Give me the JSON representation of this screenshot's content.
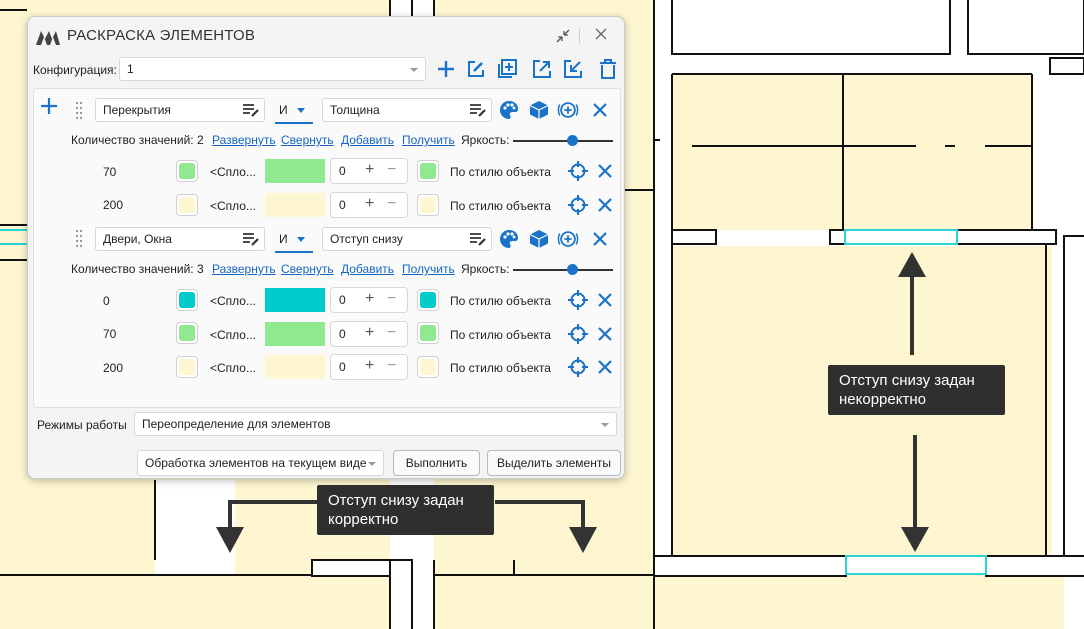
{
  "dialog": {
    "title": "РАСКРАСКА ЭЛЕМЕНТОВ",
    "config_label": "Конфигурация:",
    "config_value": "1",
    "rules": [
      {
        "category": "Перекрытия",
        "operator": "И",
        "parameter": "Толщина",
        "count_text": "Количество значений: 2",
        "expand": "Развернуть",
        "collapse": "Свернуть",
        "add": "Добавить",
        "get": "Получить",
        "brightness": "Яркость:",
        "values": [
          {
            "value": "70",
            "pattern": "<Спло...",
            "color": "#90e890",
            "offset": "0",
            "style": "По стилю объекта"
          },
          {
            "value": "200",
            "pattern": "<Спло...",
            "color": "#fdf6d0",
            "offset": "0",
            "style": "По стилю объекта"
          }
        ]
      },
      {
        "category": "Двери, Окна",
        "operator": "И",
        "parameter": "Отступ снизу",
        "count_text": "Количество значений: 3",
        "expand": "Развернуть",
        "collapse": "Свернуть",
        "add": "Добавить",
        "get": "Получить",
        "brightness": "Яркость:",
        "values": [
          {
            "value": "0",
            "pattern": "<Спло...",
            "color": "#00cccc",
            "offset": "0",
            "style": "По стилю объекта"
          },
          {
            "value": "70",
            "pattern": "<Спло...",
            "color": "#90e890",
            "offset": "0",
            "style": "По стилю объекта"
          },
          {
            "value": "200",
            "pattern": "<Спло...",
            "color": "#fdf6d0",
            "offset": "0",
            "style": "По стилю объекта"
          }
        ]
      }
    ],
    "mode_label": "Режимы работы",
    "mode_value": "Переопределение для элементов",
    "scope_value": "Обработка элементов на текущем виде",
    "run_button": "Выполнить",
    "select_button": "Выделить элементы"
  },
  "callouts": {
    "incorrect": "Отступ снизу задан некорректно",
    "correct": "Отступ снизу задан корректно"
  },
  "colors": {
    "accent": "#1a73c8",
    "floor_fill": "#fdf6d0",
    "cyan": "#00cccc",
    "green": "#90e890"
  }
}
